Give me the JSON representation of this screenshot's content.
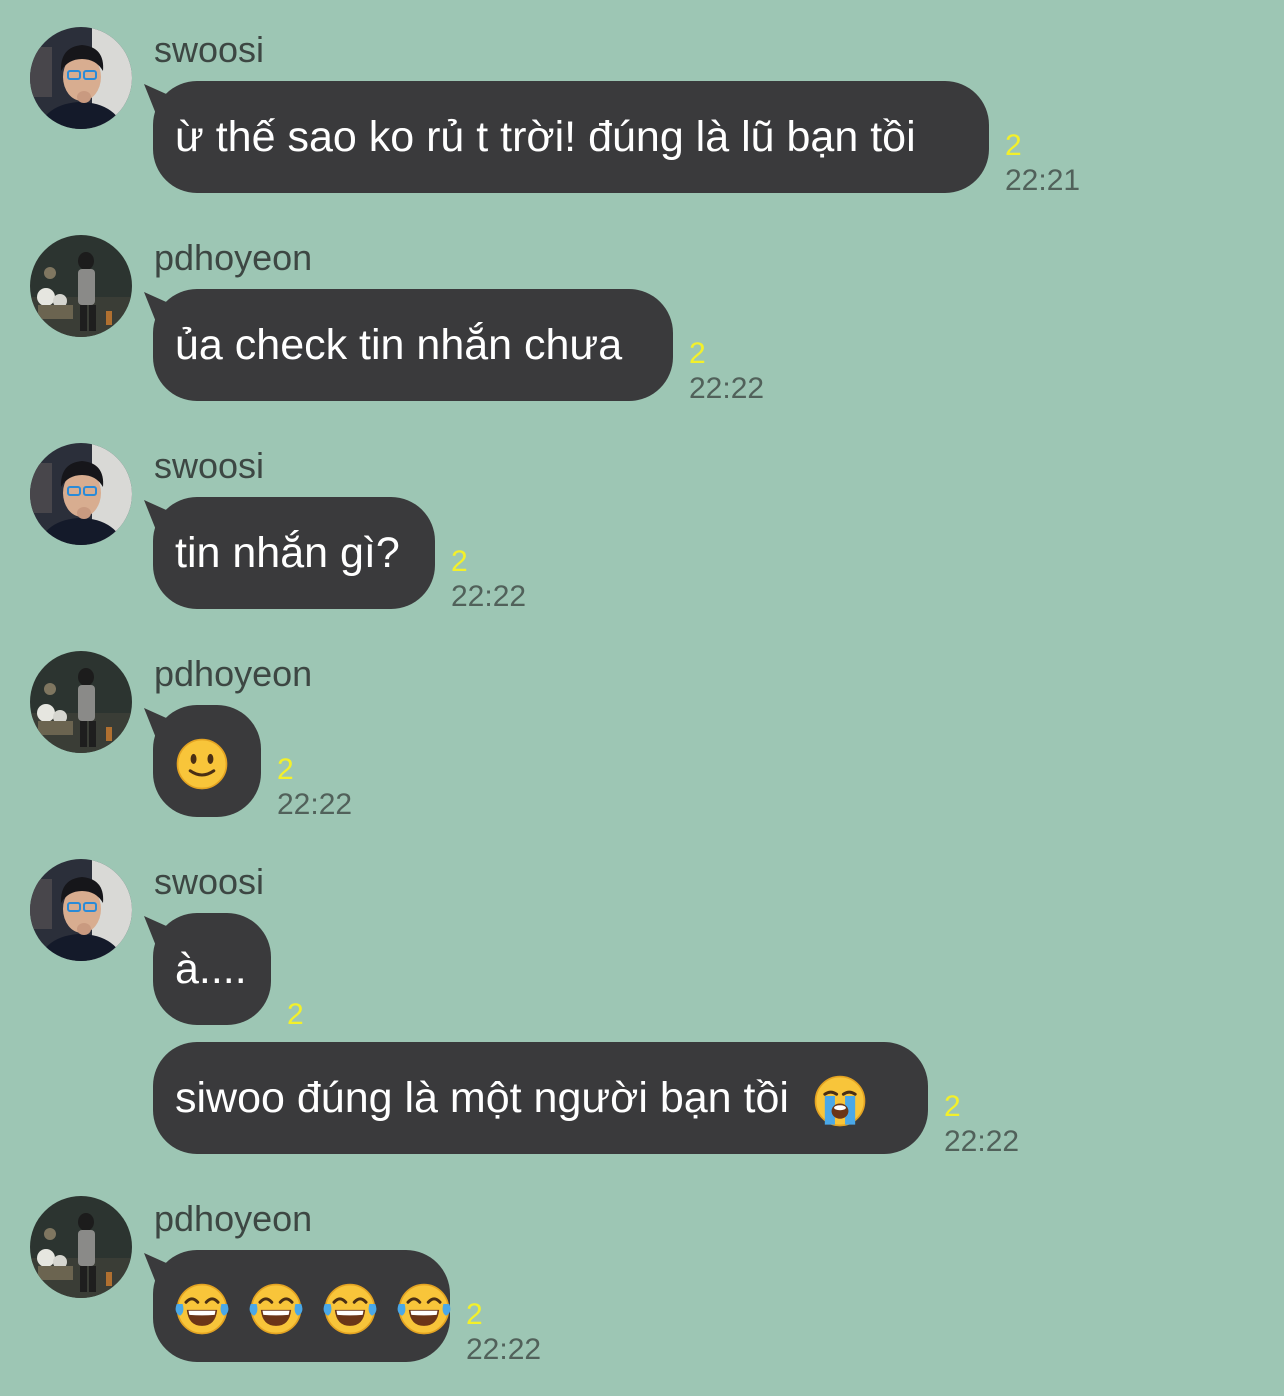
{
  "messages": [
    {
      "sender": "swoosi",
      "text": "ừ thế sao ko rủ t trời! đúng là lũ bạn tồi",
      "unread": "2",
      "time": "22:21"
    },
    {
      "sender": "pdhoyeon",
      "text": "ủa check tin nhắn chưa",
      "unread": "2",
      "time": "22:22"
    },
    {
      "sender": "swoosi",
      "text": "tin nhắn gì?",
      "unread": "2",
      "time": "22:22"
    },
    {
      "sender": "pdhoyeon",
      "emoji": "slightly-smiling-face",
      "unread": "2",
      "time": "22:22"
    },
    {
      "sender": "swoosi",
      "text": "à....",
      "unread": "2"
    },
    {
      "text": "siwoo đúng là một người bạn tồi",
      "emoji": "loudly-crying-face",
      "unread": "2",
      "time": "22:22"
    },
    {
      "sender": "pdhoyeon",
      "emoji": "face-with-tears-of-joy x4",
      "unread": "2",
      "time": "22:22"
    }
  ],
  "colors": {
    "background": "#9dc6b4",
    "bubble": "#3a3a3c",
    "bubble_text": "#ffffff",
    "unread": "#f3f02a",
    "time": "#51615a",
    "sender": "#3d4743"
  }
}
